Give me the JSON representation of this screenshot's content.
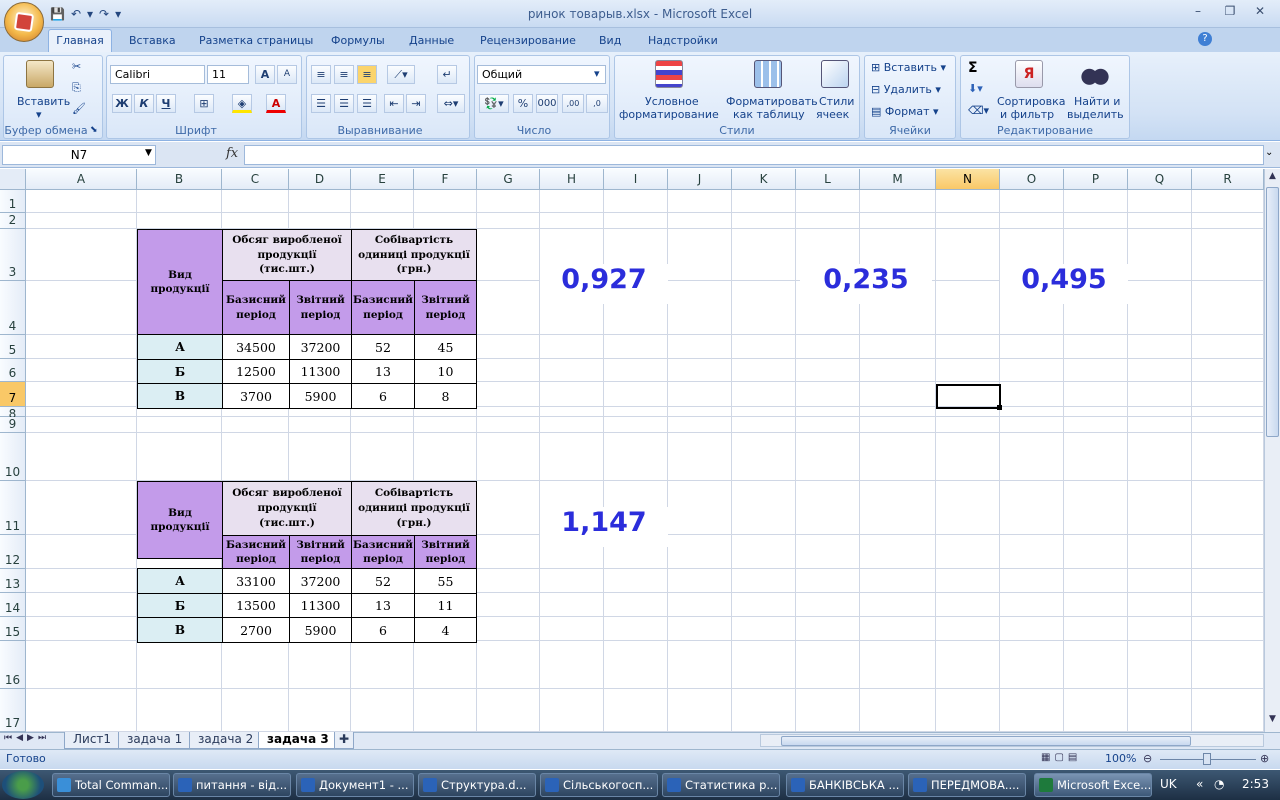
{
  "window": {
    "title": "ринок товарыв.xlsx - Microsoft Excel",
    "qat_save": "💾",
    "qat_undo": "↶",
    "qat_redo": "↷",
    "qat_more": "▾",
    "minimize": "–",
    "restore": "❐",
    "close": "✕"
  },
  "tabs": [
    "Главная",
    "Вставка",
    "Разметка страницы",
    "Формулы",
    "Данные",
    "Рецензирование",
    "Вид",
    "Надстройки"
  ],
  "ribbon": {
    "clipboard": {
      "paste": "Вставить",
      "label": "Буфер обмена"
    },
    "font": {
      "name": "Calibri",
      "size": "11",
      "grow": "A",
      "shrink": "A",
      "bold": "Ж",
      "italic": "К",
      "underline": "Ч",
      "label": "Шрифт"
    },
    "alignment": {
      "label": "Выравнивание"
    },
    "number": {
      "format": "Общий",
      "percent": "%",
      "thousands": "000",
      "inc_decimal": ",00",
      "dec_decimal": ",0",
      "label": "Число"
    },
    "styles": {
      "conditional": "Условное\nформатирование",
      "conditional_l1": "Условное",
      "conditional_l2": "форматирование",
      "table_l1": "Форматировать",
      "table_l2": "как таблицу",
      "cell_l1": "Стили",
      "cell_l2": "ячеек",
      "label": "Стили"
    },
    "cells": {
      "insert": "Вставить",
      "delete": "Удалить",
      "format": "Формат",
      "label": "Ячейки"
    },
    "editing": {
      "sigma": "Σ",
      "sort_l1": "Сортировка",
      "sort_l2": "и фильтр",
      "find_l1": "Найти и",
      "find_l2": "выделить",
      "label": "Редактирование"
    }
  },
  "formula_bar": {
    "name_box": "N7",
    "fx": "fx",
    "formula": ""
  },
  "columns": [
    "A",
    "B",
    "C",
    "D",
    "E",
    "F",
    "G",
    "H",
    "I",
    "J",
    "K",
    "L",
    "M",
    "N",
    "O",
    "P",
    "Q",
    "R"
  ],
  "rows": [
    "1",
    "2",
    "3",
    "4",
    "5",
    "6",
    "7",
    "8",
    "9",
    "10",
    "11",
    "12",
    "13",
    "14",
    "15",
    "16",
    "17"
  ],
  "table1": {
    "col_type": "Вид продукції",
    "col_volume": "Обсяг виробленої продукції (тис.шт.)",
    "col_cost": "Собівартість одиниці продукції (грн.)",
    "base": "Базисний період",
    "report": "Звітний період",
    "rows": [
      {
        "name": "А",
        "v1": "34500",
        "v2": "37200",
        "c1": "52",
        "c2": "45"
      },
      {
        "name": "Б",
        "v1": "12500",
        "v2": "11300",
        "c1": "13",
        "c2": "10"
      },
      {
        "name": "В",
        "v1": "3700",
        "v2": "5900",
        "c1": "6",
        "c2": "8"
      }
    ]
  },
  "table2": {
    "col_type": "Вид продукції",
    "col_volume": "Обсяг виробленої продукції (тис.шт.)",
    "col_cost": "Собівартість одиниці продукції (грн.)",
    "base": "Базисний період",
    "report": "Звітний період",
    "rows": [
      {
        "name": "А",
        "v1": "33100",
        "v2": "37200",
        "c1": "52",
        "c2": "55"
      },
      {
        "name": "Б",
        "v1": "13500",
        "v2": "11300",
        "c1": "13",
        "c2": "11"
      },
      {
        "name": "В",
        "v1": "2700",
        "v2": "5900",
        "c1": "6",
        "c2": "4"
      }
    ]
  },
  "results": {
    "h3": "0,927",
    "l3": "0,235",
    "o3": "0,495",
    "h11": "1,147"
  },
  "sheets": [
    "Лист1",
    "задача 1",
    "задача 2",
    "задача 3"
  ],
  "active_sheet": "задача 3",
  "status": {
    "ready": "Готово",
    "zoom": "100%"
  },
  "taskbar": {
    "items": [
      "Total Comman...",
      "питання - від...",
      "Документ1 - ...",
      "Структура.d...",
      "Сільськогосп...",
      "Статистика р...",
      "БАНКІВСЬКА ...",
      "ПЕРЕДМОВА....",
      "Microsoft Exce..."
    ],
    "lang": "UK",
    "time": "2:53"
  }
}
